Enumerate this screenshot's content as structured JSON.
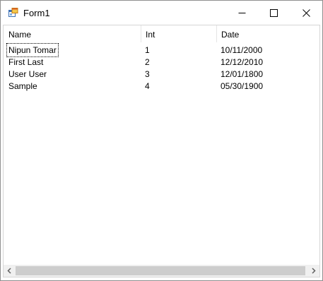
{
  "window": {
    "title": "Form1",
    "icon": "winforms-app-icon"
  },
  "caption_buttons": {
    "minimize": "minimize-icon",
    "maximize": "maximize-icon",
    "close": "close-icon"
  },
  "listview": {
    "columns": [
      "Name",
      "Int",
      "Date"
    ],
    "rows": [
      {
        "name": "Nipun Tomar",
        "int": "1",
        "date": "10/11/2000"
      },
      {
        "name": "First Last",
        "int": "2",
        "date": "12/12/2010"
      },
      {
        "name": "User User",
        "int": "3",
        "date": "12/01/1800"
      },
      {
        "name": "Sample",
        "int": "4",
        "date": "05/30/1900"
      }
    ],
    "focused_row": 0
  },
  "scrollbar": {
    "left_arrow": "chevron-left-icon",
    "right_arrow": "chevron-right-icon"
  }
}
